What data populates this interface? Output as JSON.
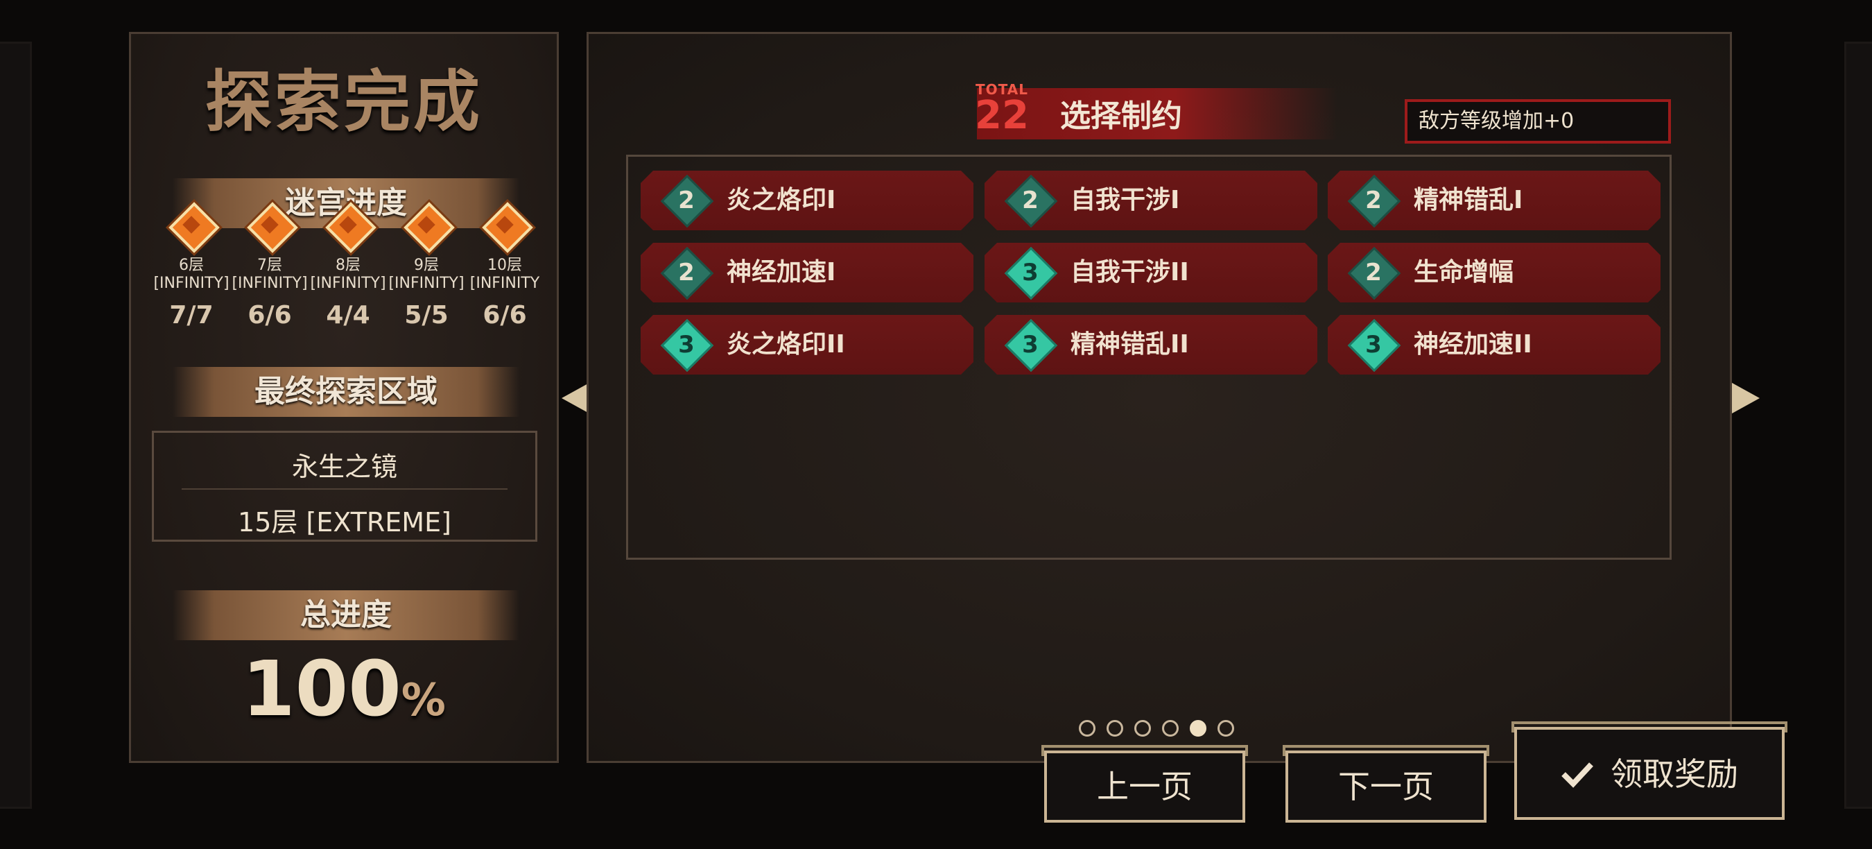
{
  "left": {
    "title": "探索完成",
    "labyrinth_progress_label": "迷宫进度",
    "floors": [
      {
        "name": "6层",
        "difficulty": "[INFINITY]",
        "count": "7/7"
      },
      {
        "name": "7层",
        "difficulty": "[INFINITY]",
        "count": "6/6"
      },
      {
        "name": "8层",
        "difficulty": "[INFINITY]",
        "count": "4/4"
      },
      {
        "name": "9层",
        "difficulty": "[INFINITY]",
        "count": "5/5"
      },
      {
        "name": "10层",
        "difficulty": "[INFINITY",
        "count": "6/6"
      }
    ],
    "final_area_label": "最终探索区域",
    "final_area_name": "永生之镜",
    "final_area_floor": "15层 [EXTREME]",
    "total_progress_label": "总进度",
    "total_progress_value": "100",
    "total_progress_unit": "%"
  },
  "right": {
    "total_label": "TOTAL",
    "total_value": "22",
    "title": "选择制约",
    "enemy_level": "敌方等级增加+0",
    "restrictions": [
      {
        "level": "2",
        "name": "炎之烙印I"
      },
      {
        "level": "2",
        "name": "自我干涉I"
      },
      {
        "level": "2",
        "name": "精神错乱I"
      },
      {
        "level": "2",
        "name": "神经加速I"
      },
      {
        "level": "3",
        "name": "自我干涉II"
      },
      {
        "level": "2",
        "name": "生命增幅"
      },
      {
        "level": "3",
        "name": "炎之烙印II"
      },
      {
        "level": "3",
        "name": "精神错乱II"
      },
      {
        "level": "3",
        "name": "神经加速II"
      }
    ],
    "pagination": {
      "total_pages": 6,
      "current_page": 5
    }
  },
  "buttons": {
    "prev": "上一页",
    "next": "下一页",
    "claim": "领取奖励"
  },
  "colors": {
    "accent_red": "#8e1a1a",
    "level2_badge": "#2a7362",
    "level3_badge": "#35c7a3",
    "gem_orange": "#ef7a22"
  }
}
